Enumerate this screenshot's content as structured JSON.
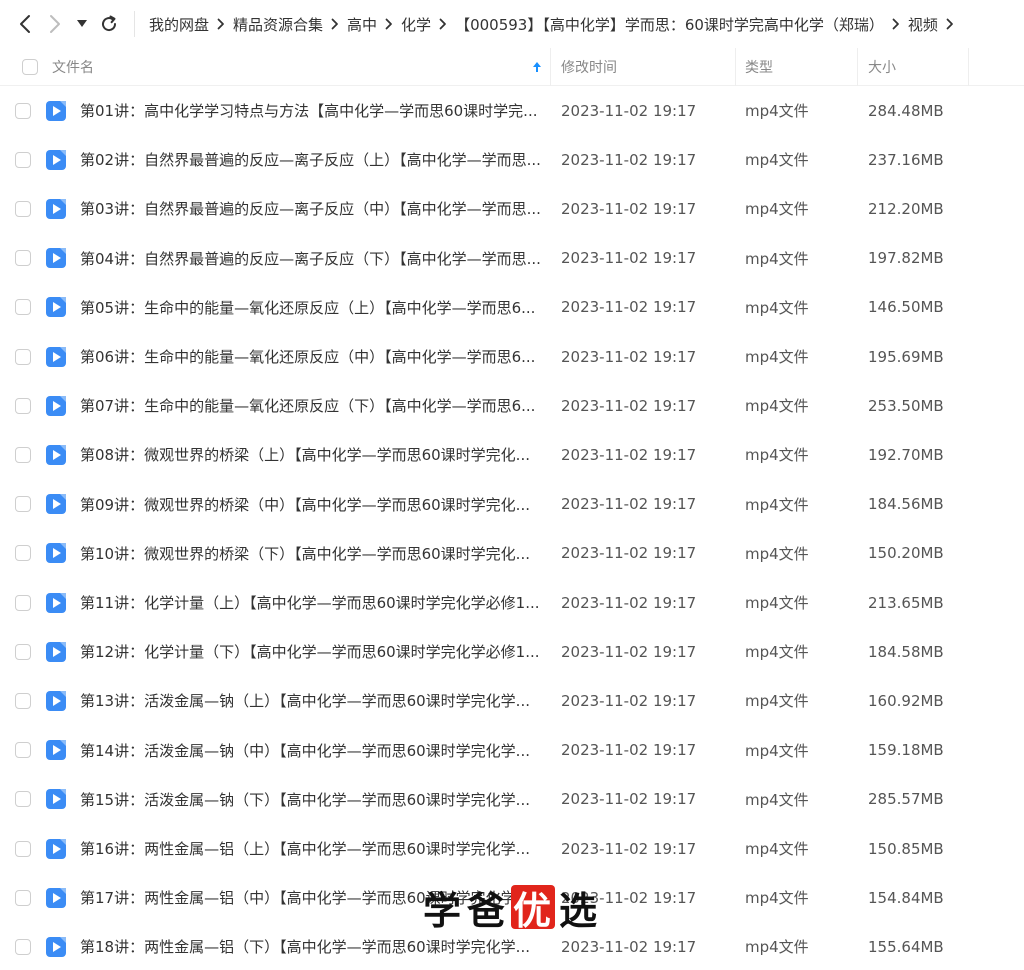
{
  "breadcrumb": [
    "我的网盘",
    "精品资源合集",
    "高中",
    "化学",
    "【000593】【高中化学】学而思：60课时学完高中化学（郑瑞）",
    "视频"
  ],
  "columns": {
    "name": "文件名",
    "mtime": "修改时间",
    "type": "类型",
    "size": "大小"
  },
  "files": [
    {
      "name": "第01讲：高中化学学习特点与方法【高中化学—学而思60课时学完...",
      "mtime": "2023-11-02 19:17",
      "type": "mp4文件",
      "size": "284.48MB"
    },
    {
      "name": "第02讲：自然界最普遍的反应—离子反应（上）【高中化学—学而思...",
      "mtime": "2023-11-02 19:17",
      "type": "mp4文件",
      "size": "237.16MB"
    },
    {
      "name": "第03讲：自然界最普遍的反应—离子反应（中）【高中化学—学而思...",
      "mtime": "2023-11-02 19:17",
      "type": "mp4文件",
      "size": "212.20MB"
    },
    {
      "name": "第04讲：自然界最普遍的反应—离子反应（下）【高中化学—学而思...",
      "mtime": "2023-11-02 19:17",
      "type": "mp4文件",
      "size": "197.82MB"
    },
    {
      "name": "第05讲：生命中的能量—氧化还原反应（上）【高中化学—学而思6...",
      "mtime": "2023-11-02 19:17",
      "type": "mp4文件",
      "size": "146.50MB"
    },
    {
      "name": "第06讲：生命中的能量—氧化还原反应（中）【高中化学—学而思6...",
      "mtime": "2023-11-02 19:17",
      "type": "mp4文件",
      "size": "195.69MB"
    },
    {
      "name": "第07讲：生命中的能量—氧化还原反应（下）【高中化学—学而思6...",
      "mtime": "2023-11-02 19:17",
      "type": "mp4文件",
      "size": "253.50MB"
    },
    {
      "name": "第08讲：微观世界的桥梁（上）【高中化学—学而思60课时学完化...",
      "mtime": "2023-11-02 19:17",
      "type": "mp4文件",
      "size": "192.70MB"
    },
    {
      "name": "第09讲：微观世界的桥梁（中）【高中化学—学而思60课时学完化...",
      "mtime": "2023-11-02 19:17",
      "type": "mp4文件",
      "size": "184.56MB"
    },
    {
      "name": "第10讲：微观世界的桥梁（下）【高中化学—学而思60课时学完化...",
      "mtime": "2023-11-02 19:17",
      "type": "mp4文件",
      "size": "150.20MB"
    },
    {
      "name": "第11讲：化学计量（上）【高中化学—学而思60课时学完化学必修1...",
      "mtime": "2023-11-02 19:17",
      "type": "mp4文件",
      "size": "213.65MB"
    },
    {
      "name": "第12讲：化学计量（下）【高中化学—学而思60课时学完化学必修1...",
      "mtime": "2023-11-02 19:17",
      "type": "mp4文件",
      "size": "184.58MB"
    },
    {
      "name": "第13讲：活泼金属—钠（上）【高中化学—学而思60课时学完化学...",
      "mtime": "2023-11-02 19:17",
      "type": "mp4文件",
      "size": "160.92MB"
    },
    {
      "name": "第14讲：活泼金属—钠（中）【高中化学—学而思60课时学完化学...",
      "mtime": "2023-11-02 19:17",
      "type": "mp4文件",
      "size": "159.18MB"
    },
    {
      "name": "第15讲：活泼金属—钠（下）【高中化学—学而思60课时学完化学...",
      "mtime": "2023-11-02 19:17",
      "type": "mp4文件",
      "size": "285.57MB"
    },
    {
      "name": "第16讲：两性金属—铝（上）【高中化学—学而思60课时学完化学...",
      "mtime": "2023-11-02 19:17",
      "type": "mp4文件",
      "size": "150.85MB"
    },
    {
      "name": "第17讲：两性金属—铝（中）【高中化学—学而思60课时学完化学...",
      "mtime": "2023-11-02 19:17",
      "type": "mp4文件",
      "size": "154.84MB"
    },
    {
      "name": "第18讲：两性金属—铝（下）【高中化学—学而思60课时学完化学...",
      "mtime": "2023-11-02 19:17",
      "type": "mp4文件",
      "size": "155.64MB"
    }
  ],
  "watermark": {
    "chars": [
      "学",
      "爸",
      "优",
      "选"
    ]
  },
  "icons": {
    "back": "chevron-left-icon",
    "forward": "chevron-right-icon",
    "history": "caret-down-icon",
    "refresh": "refresh-icon",
    "breadcrumb_separator": "chevron-right-icon",
    "sort": "sort-arrow-up-icon",
    "file": "video-file-icon"
  },
  "colors": {
    "accent": "#1890ff",
    "video_icon": "#3b8cf5",
    "watermark_red": "#e1251b"
  }
}
